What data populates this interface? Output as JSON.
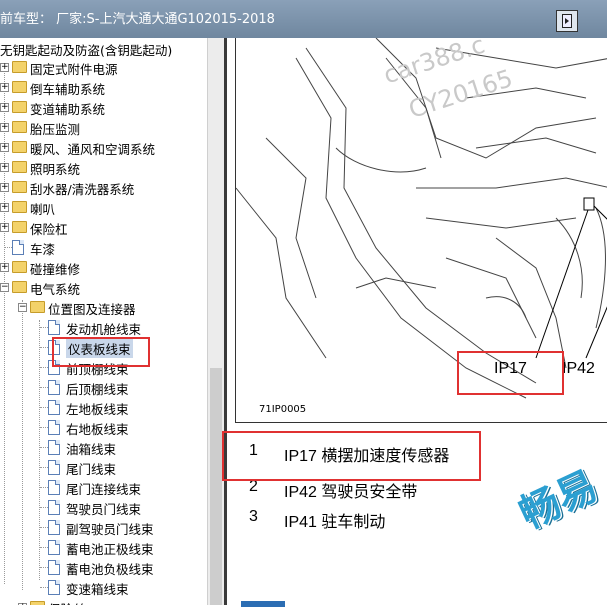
{
  "window": {
    "title": "前车型： 厂家:S-上汽大通大通G102015-2018"
  },
  "tree": {
    "cut_label": "无钥匙起动及防盗(含钥匙起动)",
    "items": [
      {
        "label": "固定式附件电源",
        "type": "folder"
      },
      {
        "label": "倒车辅助系统",
        "type": "folder"
      },
      {
        "label": "变道辅助系统",
        "type": "folder"
      },
      {
        "label": "胎压监测",
        "type": "folder"
      },
      {
        "label": "暖风、通风和空调系统",
        "type": "folder"
      },
      {
        "label": "照明系统",
        "type": "folder"
      },
      {
        "label": "刮水器/清洗器系统",
        "type": "folder"
      },
      {
        "label": "喇叭",
        "type": "folder"
      },
      {
        "label": "保险杠",
        "type": "folder"
      },
      {
        "label": "车漆",
        "type": "doc"
      },
      {
        "label": "碰撞维修",
        "type": "folder"
      },
      {
        "label": "电气系统",
        "type": "folder"
      },
      {
        "label": "位置图及连接器",
        "type": "folder"
      },
      {
        "label": "发动机舱线束",
        "type": "doc"
      },
      {
        "label": "仪表板线束",
        "type": "doc",
        "selected": true
      },
      {
        "label": "前顶棚线束",
        "type": "doc"
      },
      {
        "label": "后顶棚线束",
        "type": "doc"
      },
      {
        "label": "左地板线束",
        "type": "doc"
      },
      {
        "label": "右地板线束",
        "type": "doc"
      },
      {
        "label": "油箱线束",
        "type": "doc"
      },
      {
        "label": "尾门线束",
        "type": "doc"
      },
      {
        "label": "尾门连接线束",
        "type": "doc"
      },
      {
        "label": "驾驶员门线束",
        "type": "doc"
      },
      {
        "label": "副驾驶员门线束",
        "type": "doc"
      },
      {
        "label": "蓄电池正极线束",
        "type": "doc"
      },
      {
        "label": "蓄电池负极线束",
        "type": "doc"
      },
      {
        "label": "变速箱线束",
        "type": "doc"
      },
      {
        "label": "保险丝",
        "type": "folder"
      }
    ]
  },
  "figure": {
    "id": "71IP0005",
    "callouts": [
      "IP17",
      "IP42"
    ],
    "watermark": [
      "car388.c",
      "CY20165"
    ]
  },
  "legend": [
    {
      "num": "1",
      "text": "IP17 横摆加速度传感器"
    },
    {
      "num": "2",
      "text": "IP42 驾驶员安全带"
    },
    {
      "num": "3",
      "text": "IP41 驻车制动"
    }
  ],
  "brand_watermark": "畅易"
}
